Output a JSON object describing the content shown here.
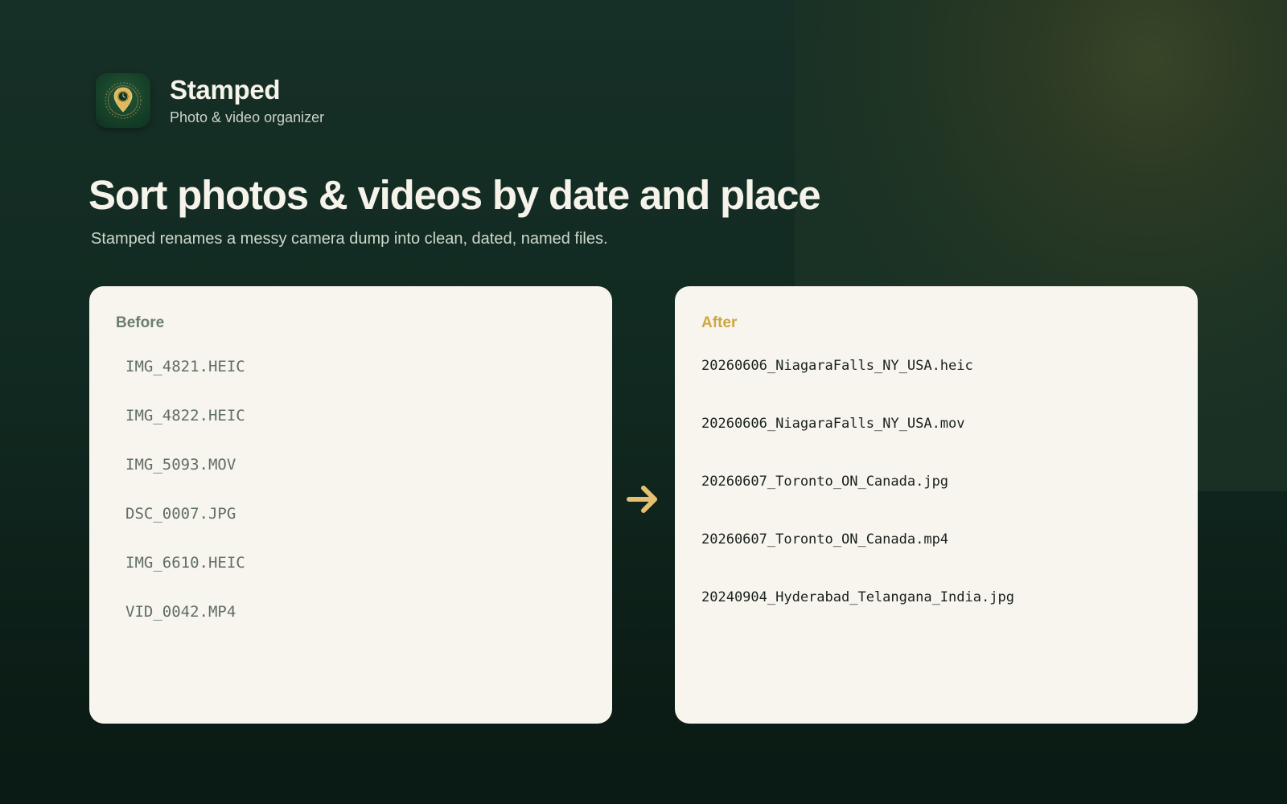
{
  "colors": {
    "background": "#112a21",
    "card": "#f8f5ee",
    "accent_gold": "#d0a646",
    "before_label": "#6a7d6e",
    "arrow": "#e4c070"
  },
  "app": {
    "icon": "location-pin-clock-icon",
    "name": "Stamped",
    "subtitle": "Photo & video organizer"
  },
  "hero": {
    "headline": "Sort photos & videos by date and place",
    "subheadline": "Stamped renames a messy camera dump into clean, dated, named files."
  },
  "before": {
    "label": "Before",
    "files": [
      "IMG_4821.HEIC",
      "IMG_4822.HEIC",
      "IMG_5093.MOV",
      "DSC_0007.JPG",
      "IMG_6610.HEIC",
      "VID_0042.MP4"
    ]
  },
  "transition": {
    "icon": "arrow-right-icon"
  },
  "after": {
    "label": "After",
    "files": [
      "20260606_NiagaraFalls_NY_USA.heic",
      "20260606_NiagaraFalls_NY_USA.mov",
      "20260607_Toronto_ON_Canada.jpg",
      "20260607_Toronto_ON_Canada.mp4",
      "20240904_Hyderabad_Telangana_India.jpg"
    ]
  }
}
